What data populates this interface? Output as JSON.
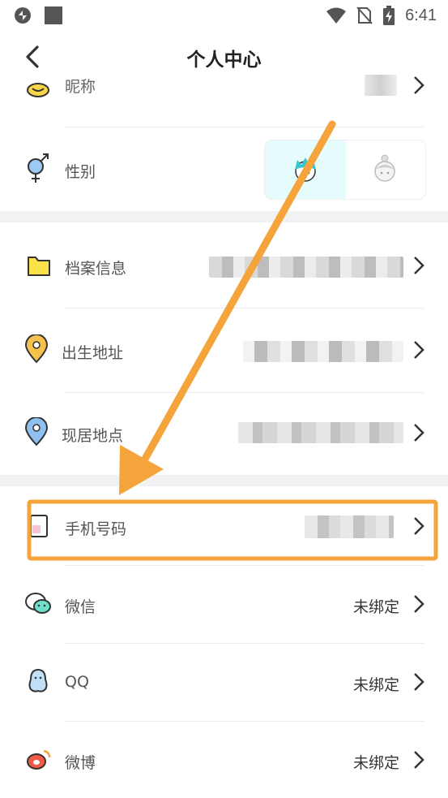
{
  "status_bar": {
    "time": "6:41"
  },
  "header": {
    "title": "个人中心"
  },
  "rows": {
    "nickname": {
      "label": "昵称"
    },
    "gender": {
      "label": "性别"
    },
    "profile": {
      "label": "档案信息"
    },
    "birthplace": {
      "label": "出生地址"
    },
    "residence": {
      "label": "现居地点"
    },
    "phone": {
      "label": "手机号码"
    },
    "wechat": {
      "label": "微信",
      "value": "未绑定"
    },
    "qq": {
      "label": "QQ",
      "value": "未绑定"
    },
    "weibo": {
      "label": "微博",
      "value": "未绑定"
    }
  },
  "colors": {
    "annotation": "#f5a43c",
    "male_selected_bg": "#e6fbfb"
  }
}
